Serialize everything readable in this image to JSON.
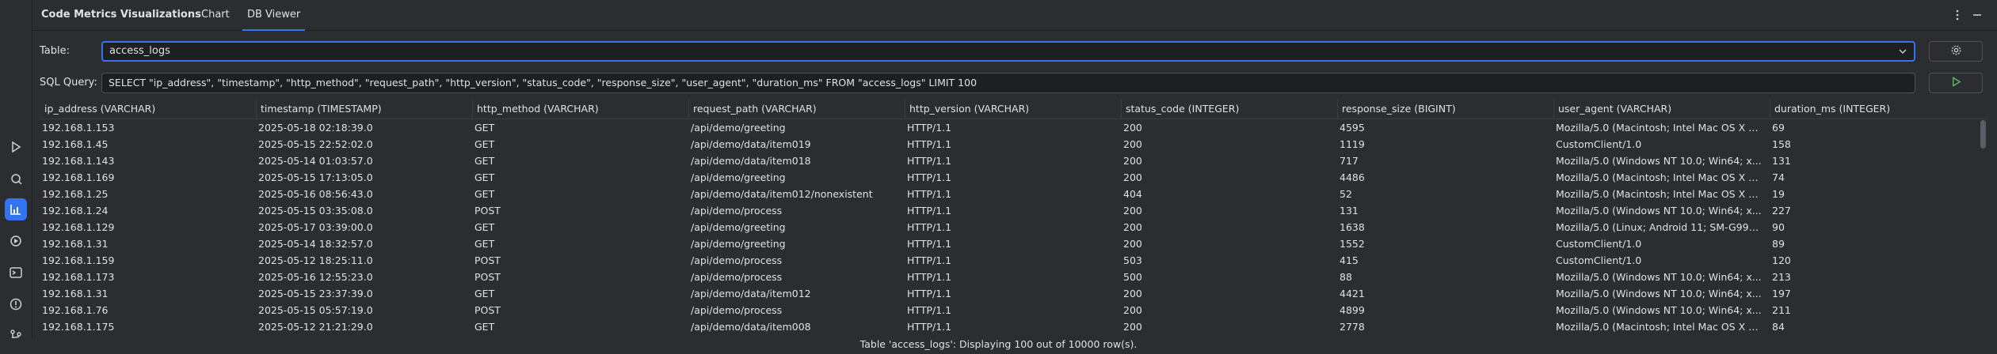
{
  "sidebar": {
    "icons": [
      {
        "name": "run-icon",
        "active": false
      },
      {
        "name": "services-icon",
        "active": false
      },
      {
        "name": "chart-icon",
        "active": true
      },
      {
        "name": "debug-icon",
        "active": false
      },
      {
        "name": "terminal-icon",
        "active": false
      },
      {
        "name": "problems-icon",
        "active": false
      },
      {
        "name": "git-icon",
        "active": false
      }
    ]
  },
  "header": {
    "title": "Code Metrics Visualizations",
    "tabs": [
      {
        "label": "Chart",
        "active": false
      },
      {
        "label": "DB Viewer",
        "active": true
      }
    ],
    "more_icon": "more-vertical-icon",
    "minimize_icon": "minimize-icon"
  },
  "controls": {
    "table_label": "Table:",
    "table_value": "access_logs",
    "sql_label": "SQL Query:",
    "sql_value": "SELECT \"ip_address\", \"timestamp\", \"http_method\", \"request_path\", \"http_version\", \"status_code\", \"response_size\", \"user_agent\", \"duration_ms\" FROM \"access_logs\" LIMIT 100"
  },
  "table": {
    "columns": [
      "ip_address (VARCHAR)",
      "timestamp (TIMESTAMP)",
      "http_method (VARCHAR)",
      "request_path (VARCHAR)",
      "http_version (VARCHAR)",
      "status_code (INTEGER)",
      "response_size (BIGINT)",
      "user_agent (VARCHAR)",
      "duration_ms (INTEGER)"
    ],
    "rows": [
      [
        "192.168.1.153",
        "2025-05-18 02:18:39.0",
        "GET",
        "/api/demo/greeting",
        "HTTP/1.1",
        "200",
        "4595",
        "Mozilla/5.0 (Macintosh; Intel Mac OS X 1...",
        "69"
      ],
      [
        "192.168.1.45",
        "2025-05-15 22:52:02.0",
        "GET",
        "/api/demo/data/item019",
        "HTTP/1.1",
        "200",
        "1119",
        "CustomClient/1.0",
        "158"
      ],
      [
        "192.168.1.143",
        "2025-05-14 01:03:57.0",
        "GET",
        "/api/demo/data/item018",
        "HTTP/1.1",
        "200",
        "717",
        "Mozilla/5.0 (Windows NT 10.0; Win64; x...",
        "131"
      ],
      [
        "192.168.1.169",
        "2025-05-15 17:13:05.0",
        "GET",
        "/api/demo/greeting",
        "HTTP/1.1",
        "200",
        "4486",
        "Mozilla/5.0 (Macintosh; Intel Mac OS X 1...",
        "74"
      ],
      [
        "192.168.1.25",
        "2025-05-16 08:56:43.0",
        "GET",
        "/api/demo/data/item012/nonexistent",
        "HTTP/1.1",
        "404",
        "52",
        "Mozilla/5.0 (Macintosh; Intel Mac OS X 1...",
        "19"
      ],
      [
        "192.168.1.24",
        "2025-05-15 03:35:08.0",
        "POST",
        "/api/demo/process",
        "HTTP/1.1",
        "200",
        "131",
        "Mozilla/5.0 (Windows NT 10.0; Win64; x...",
        "227"
      ],
      [
        "192.168.1.129",
        "2025-05-17 03:39:00.0",
        "GET",
        "/api/demo/greeting",
        "HTTP/1.1",
        "200",
        "1638",
        "Mozilla/5.0 (Linux; Android 11; SM-G991...",
        "90"
      ],
      [
        "192.168.1.31",
        "2025-05-14 18:32:57.0",
        "GET",
        "/api/demo/greeting",
        "HTTP/1.1",
        "200",
        "1552",
        "CustomClient/1.0",
        "89"
      ],
      [
        "192.168.1.159",
        "2025-05-12 18:25:11.0",
        "POST",
        "/api/demo/process",
        "HTTP/1.1",
        "503",
        "415",
        "CustomClient/1.0",
        "120"
      ],
      [
        "192.168.1.173",
        "2025-05-16 12:55:23.0",
        "POST",
        "/api/demo/process",
        "HTTP/1.1",
        "500",
        "88",
        "Mozilla/5.0 (Windows NT 10.0; Win64; x...",
        "213"
      ],
      [
        "192.168.1.31",
        "2025-05-15 23:37:39.0",
        "GET",
        "/api/demo/data/item012",
        "HTTP/1.1",
        "200",
        "4421",
        "Mozilla/5.0 (Windows NT 10.0; Win64; x...",
        "197"
      ],
      [
        "192.168.1.76",
        "2025-05-15 05:57:19.0",
        "POST",
        "/api/demo/process",
        "HTTP/1.1",
        "200",
        "4899",
        "Mozilla/5.0 (Windows NT 10.0; Win64; x...",
        "211"
      ],
      [
        "192.168.1.175",
        "2025-05-12 21:21:29.0",
        "GET",
        "/api/demo/data/item008",
        "HTTP/1.1",
        "200",
        "2778",
        "Mozilla/5.0 (Macintosh; Intel Mac OS X 1...",
        "84"
      ]
    ]
  },
  "status": "Table 'access_logs': Displaying 100 out of 10000 row(s).",
  "colors": {
    "accent": "#3574f0",
    "background": "#2b2d30",
    "input_bg": "#1e1f22"
  }
}
